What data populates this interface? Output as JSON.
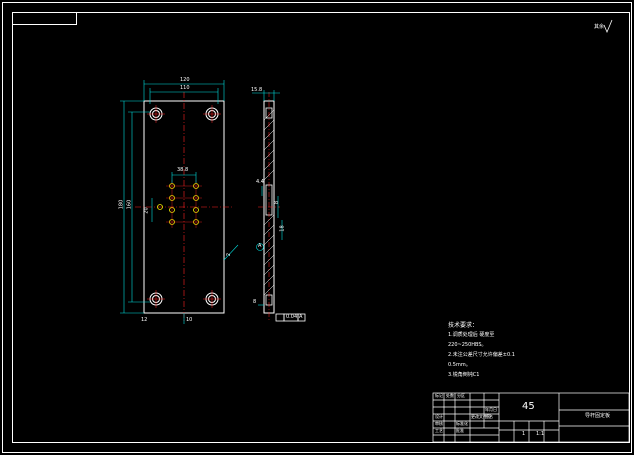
{
  "drawing": {
    "roughness_note": "其余",
    "material": "45",
    "part_name": "导杆固定板",
    "tech_requirements": {
      "heading": "技术要求：",
      "items": [
        "1.调质处理后 硬度至",
        "220~250HBS。",
        "2.未注公差尺寸允许偏差±0.1",
        "0.5mm。",
        "3.锐角倒钝C1"
      ]
    },
    "dimensions": {
      "top_width": "120",
      "top_width_inner": "110",
      "left_height_outer": "180",
      "left_height_inner": "160",
      "hole_spacing_x": "38.8",
      "hole_spacing_y": "20",
      "right_r": "2",
      "side_top": "15.8",
      "side_mid": "4.4",
      "side_pitch": "8",
      "side_dia": "18",
      "side_bottom": "8",
      "bottom_label": "10",
      "datum_label": "A",
      "tol_frame": "0.04",
      "center_label": "12"
    },
    "title_block": {
      "scale": "1:1",
      "sheet": "1",
      "rows": [
        "标记",
        "处数",
        "分区",
        "更改文件号",
        "签名",
        "年月日",
        "设计",
        "审核",
        "工艺",
        "标准化",
        "批准"
      ]
    },
    "colors": {
      "background": "#000000",
      "line": "#ffffff",
      "center_line": "#ff2020",
      "dimension": "#00e0e0",
      "hatch": "#ffffff"
    }
  }
}
